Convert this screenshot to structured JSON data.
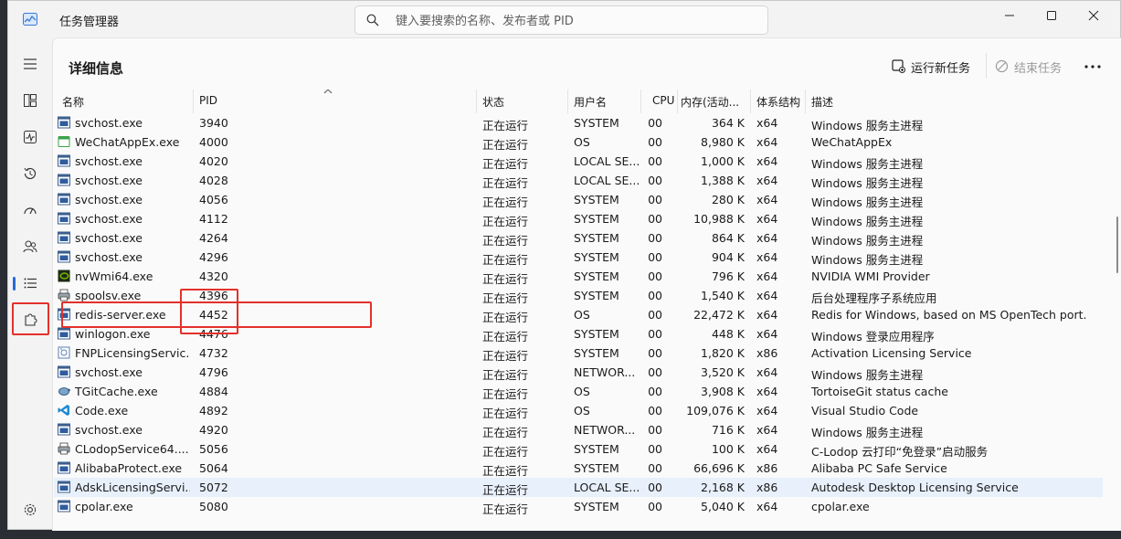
{
  "app": {
    "title": "任务管理器"
  },
  "search": {
    "placeholder": "键入要搜索的名称、发布者或 PID"
  },
  "page": {
    "title": "详细信息"
  },
  "toolbar": {
    "run_new_task": "运行新任务",
    "end_task": "结束任务"
  },
  "columns": [
    "名称",
    "PID",
    "状态",
    "用户名",
    "CPU",
    "内存(活动...",
    "体系结构",
    "描述"
  ],
  "rows": [
    {
      "name": "svchost.exe",
      "pid": "3940",
      "status": "正在运行",
      "user": "SYSTEM",
      "cpu": "00",
      "mem": "364 K",
      "arch": "x64",
      "desc": "Windows 服务主进程",
      "icon": "service-icon"
    },
    {
      "name": "WeChatAppEx.exe",
      "pid": "4000",
      "status": "正在运行",
      "user": "OS",
      "cpu": "00",
      "mem": "8,980 K",
      "arch": "x64",
      "desc": "WeChatAppEx",
      "icon": "wechat-icon"
    },
    {
      "name": "svchost.exe",
      "pid": "4020",
      "status": "正在运行",
      "user": "LOCAL SE...",
      "cpu": "00",
      "mem": "1,000 K",
      "arch": "x64",
      "desc": "Windows 服务主进程",
      "icon": "service-icon"
    },
    {
      "name": "svchost.exe",
      "pid": "4028",
      "status": "正在运行",
      "user": "LOCAL SE...",
      "cpu": "00",
      "mem": "1,388 K",
      "arch": "x64",
      "desc": "Windows 服务主进程",
      "icon": "service-icon"
    },
    {
      "name": "svchost.exe",
      "pid": "4056",
      "status": "正在运行",
      "user": "SYSTEM",
      "cpu": "00",
      "mem": "280 K",
      "arch": "x64",
      "desc": "Windows 服务主进程",
      "icon": "service-icon"
    },
    {
      "name": "svchost.exe",
      "pid": "4112",
      "status": "正在运行",
      "user": "SYSTEM",
      "cpu": "00",
      "mem": "10,988 K",
      "arch": "x64",
      "desc": "Windows 服务主进程",
      "icon": "service-icon"
    },
    {
      "name": "svchost.exe",
      "pid": "4264",
      "status": "正在运行",
      "user": "SYSTEM",
      "cpu": "00",
      "mem": "864 K",
      "arch": "x64",
      "desc": "Windows 服务主进程",
      "icon": "service-icon"
    },
    {
      "name": "svchost.exe",
      "pid": "4296",
      "status": "正在运行",
      "user": "SYSTEM",
      "cpu": "00",
      "mem": "904 K",
      "arch": "x64",
      "desc": "Windows 服务主进程",
      "icon": "service-icon"
    },
    {
      "name": "nvWmi64.exe",
      "pid": "4320",
      "status": "正在运行",
      "user": "SYSTEM",
      "cpu": "00",
      "mem": "796 K",
      "arch": "x64",
      "desc": "NVIDIA WMI Provider",
      "icon": "nvidia-icon"
    },
    {
      "name": "spoolsv.exe",
      "pid": "4396",
      "status": "正在运行",
      "user": "SYSTEM",
      "cpu": "00",
      "mem": "1,540 K",
      "arch": "x64",
      "desc": "后台处理程序子系统应用",
      "icon": "printer-icon"
    },
    {
      "name": "redis-server.exe",
      "pid": "4452",
      "status": "正在运行",
      "user": "OS",
      "cpu": "00",
      "mem": "22,472 K",
      "arch": "x64",
      "desc": "Redis for Windows, based on MS OpenTech port.",
      "icon": "service-icon"
    },
    {
      "name": "winlogon.exe",
      "pid": "4476",
      "status": "正在运行",
      "user": "SYSTEM",
      "cpu": "00",
      "mem": "448 K",
      "arch": "x64",
      "desc": "Windows 登录应用程序",
      "icon": "service-icon"
    },
    {
      "name": "FNPLicensingServic...",
      "pid": "4732",
      "status": "正在运行",
      "user": "SYSTEM",
      "cpu": "00",
      "mem": "1,820 K",
      "arch": "x86",
      "desc": "Activation Licensing Service",
      "icon": "license-icon"
    },
    {
      "name": "svchost.exe",
      "pid": "4796",
      "status": "正在运行",
      "user": "NETWOR...",
      "cpu": "00",
      "mem": "3,520 K",
      "arch": "x64",
      "desc": "Windows 服务主进程",
      "icon": "service-icon"
    },
    {
      "name": "TGitCache.exe",
      "pid": "4884",
      "status": "正在运行",
      "user": "OS",
      "cpu": "00",
      "mem": "3,908 K",
      "arch": "x64",
      "desc": "TortoiseGit status cache",
      "icon": "tortoisegit-icon"
    },
    {
      "name": "Code.exe",
      "pid": "4892",
      "status": "正在运行",
      "user": "OS",
      "cpu": "00",
      "mem": "109,076 K",
      "arch": "x64",
      "desc": "Visual Studio Code",
      "icon": "vscode-icon"
    },
    {
      "name": "svchost.exe",
      "pid": "4920",
      "status": "正在运行",
      "user": "NETWOR...",
      "cpu": "00",
      "mem": "716 K",
      "arch": "x64",
      "desc": "Windows 服务主进程",
      "icon": "service-icon"
    },
    {
      "name": "CLodopService64....",
      "pid": "5056",
      "status": "正在运行",
      "user": "SYSTEM",
      "cpu": "00",
      "mem": "100 K",
      "arch": "x64",
      "desc": "C-Lodop 云打印“免登录”启动服务",
      "icon": "printer-icon"
    },
    {
      "name": "AlibabaProtect.exe",
      "pid": "5064",
      "status": "正在运行",
      "user": "SYSTEM",
      "cpu": "00",
      "mem": "66,696 K",
      "arch": "x86",
      "desc": "Alibaba PC Safe Service",
      "icon": "service-icon"
    },
    {
      "name": "AdskLicensingServi...",
      "pid": "5072",
      "status": "正在运行",
      "user": "LOCAL SE...",
      "cpu": "00",
      "mem": "2,168 K",
      "arch": "x86",
      "desc": "Autodesk Desktop Licensing Service",
      "icon": "service-icon",
      "selected": true
    },
    {
      "name": "cpolar.exe",
      "pid": "5080",
      "status": "正在运行",
      "user": "SYSTEM",
      "cpu": "00",
      "mem": "5,040 K",
      "arch": "x64",
      "desc": "cpolar.exe",
      "icon": "service-icon"
    }
  ]
}
